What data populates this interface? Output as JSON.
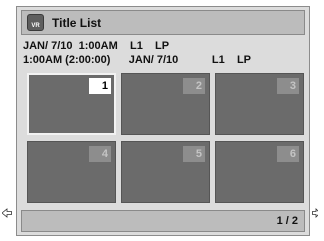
{
  "header": {
    "icon": "vr-disc-icon",
    "icon_label": "VR",
    "title": "Title List"
  },
  "info": {
    "line1": "JAN/ 7/10  1:00AM    L1    LP",
    "line2": "1:00AM (2:00:00)      JAN/ 7/10           L1    LP"
  },
  "thumbnails": [
    {
      "number": "1",
      "selected": true
    },
    {
      "number": "2",
      "selected": false
    },
    {
      "number": "3",
      "selected": false
    },
    {
      "number": "4",
      "selected": false
    },
    {
      "number": "5",
      "selected": false
    },
    {
      "number": "6",
      "selected": false
    }
  ],
  "navigation": {
    "left_icon": "arrow-left-icon",
    "right_icon": "arrow-right-icon"
  },
  "footer": {
    "page_indicator": "1 / 2"
  }
}
